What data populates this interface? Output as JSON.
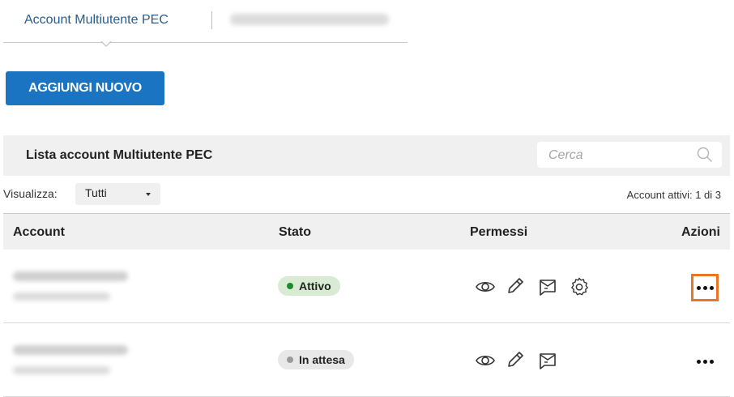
{
  "tabs": {
    "active_label": "Account Multiutente PEC"
  },
  "toolbar": {
    "add_label": "AGGIUNGI NUOVO"
  },
  "list": {
    "title": "Lista account Multiutente PEC",
    "search_placeholder": "Cerca"
  },
  "filter": {
    "label": "Visualizza:",
    "value": "Tutti",
    "active_count": "Account attivi: 1 di 3"
  },
  "table": {
    "headers": {
      "account": "Account",
      "stato": "Stato",
      "permessi": "Permessi",
      "azioni": "Azioni"
    },
    "rows": [
      {
        "status": "Attivo",
        "status_color": "#1f8a2a",
        "permissions": [
          "eye-icon",
          "pencil-icon",
          "mail-icon",
          "gear-icon"
        ]
      },
      {
        "status": "In attesa",
        "status_color": "#9a9a9a",
        "permissions": [
          "eye-icon",
          "pencil-icon",
          "mail-icon"
        ]
      }
    ]
  },
  "colors": {
    "primary": "#1a74c2",
    "tab_active": "#2a5c8a",
    "highlight": "#e8762a"
  }
}
